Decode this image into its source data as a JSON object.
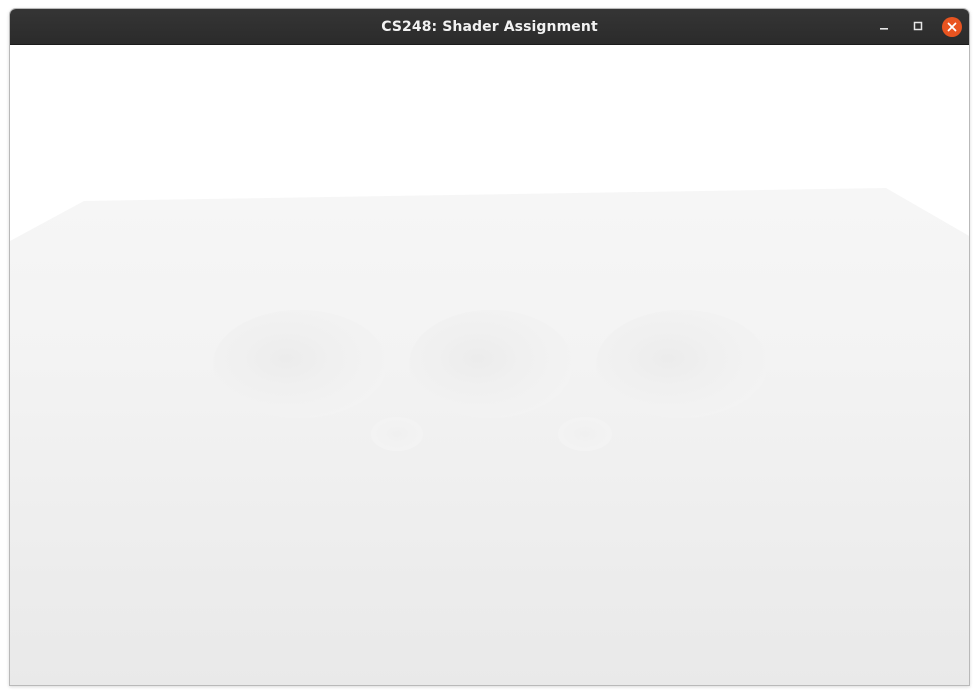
{
  "window": {
    "title": "CS248: Shader Assignment",
    "controls": {
      "minimize_icon": "minimize-icon",
      "maximize_icon": "maximize-icon",
      "close_icon": "close-icon"
    }
  },
  "colors": {
    "titlebar": "#2c2c2c",
    "title_text": "#f2f2f2",
    "close_accent": "#e95420",
    "background": "#ffffff",
    "floor_near": "#eaeaea",
    "floor_far": "#f4f4f4",
    "sphere": "#efefef"
  }
}
